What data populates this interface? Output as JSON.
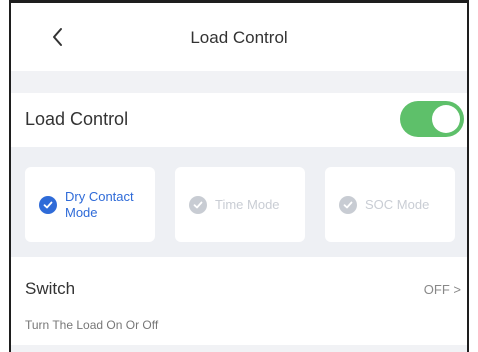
{
  "header": {
    "title": "Load Control",
    "back_icon": "chevron-left-icon"
  },
  "load_control": {
    "label": "Load Control",
    "enabled": true,
    "toggle_color": "#5ec06a"
  },
  "modes": [
    {
      "label_line1": "Dry Contact",
      "label_line2": "Mode",
      "selected": true
    },
    {
      "label_line1": "Time Mode",
      "label_line2": "",
      "selected": false
    },
    {
      "label_line1": "SOC Mode",
      "label_line2": "",
      "selected": false
    }
  ],
  "switch": {
    "label": "Switch",
    "value": "OFF",
    "chevron": ">",
    "description": "Turn The Load On Or Off"
  },
  "colors": {
    "accent": "#2f6bd8",
    "inactive": "#c8ccd3"
  }
}
